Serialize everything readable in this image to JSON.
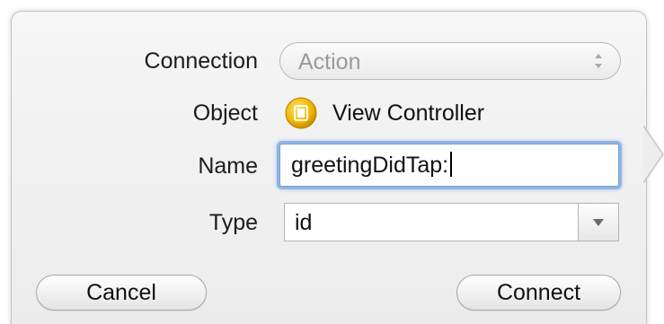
{
  "dialog": {
    "connection": {
      "label": "Connection",
      "value": "Action"
    },
    "object": {
      "label": "Object",
      "value": "View Controller",
      "icon": "view-controller-icon",
      "icon_color": "#f1b400"
    },
    "name": {
      "label": "Name",
      "value": "greetingDidTap:"
    },
    "type": {
      "label": "Type",
      "value": "id"
    },
    "buttons": {
      "cancel": "Cancel",
      "connect": "Connect"
    }
  }
}
